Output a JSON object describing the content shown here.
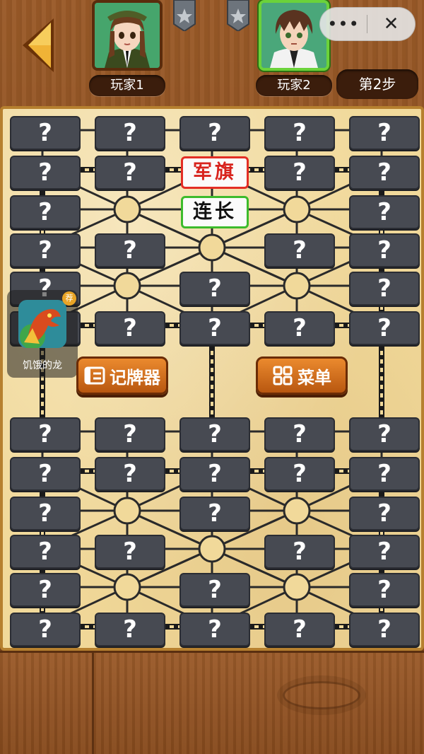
{
  "players": {
    "p1": {
      "name": "玩家1"
    },
    "p2": {
      "name": "玩家2"
    }
  },
  "step": "第2步",
  "capsule": {
    "more": "•••",
    "close": "✕"
  },
  "board": {
    "hidden_label": "?",
    "pieces": [
      {
        "text": "军旗",
        "color": "red"
      },
      {
        "text": "连长",
        "color": "green"
      }
    ],
    "buttons": {
      "record": "记牌器",
      "menu": "菜单"
    }
  },
  "ad": {
    "title": "饥饿的龙",
    "badge": "荐"
  },
  "colors": {
    "tile": "#474a52",
    "board": "#f1d99a",
    "red_piece": "#d8231d",
    "green_border": "#3dbb2c",
    "button": "#d77020"
  }
}
